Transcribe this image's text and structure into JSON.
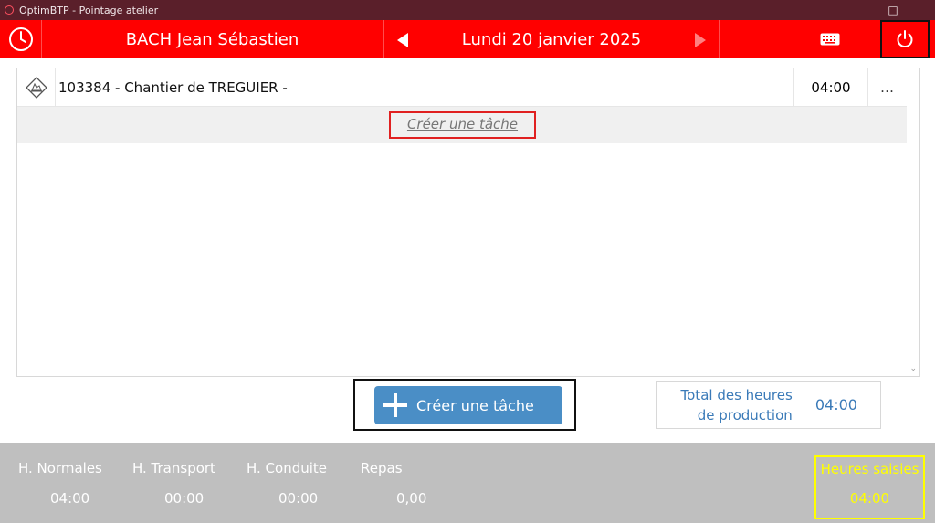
{
  "window": {
    "title": "OptimBTP - Pointage atelier",
    "maximize_glyph": "□",
    "close_glyph": "✕"
  },
  "header": {
    "employee_name": "BACH Jean Sébastien",
    "date_label": "Lundi 20 janvier 2025",
    "icons": [
      "clock-icon",
      "prev-day-icon",
      "next-day-icon",
      "keyboard-icon",
      "power-icon"
    ],
    "colors": {
      "header_bg": "#ff0000",
      "titlebar_bg": "#5a1f2a"
    }
  },
  "list": {
    "items": [
      {
        "label": "103384 - Chantier de TREGUIER -",
        "hours": "04:00",
        "more": "…",
        "icon": "site-icon"
      }
    ],
    "create_task_link": "Créer une tâche"
  },
  "actions": {
    "create_task_button": "Créer une tâche",
    "button_color": "#4a8ec6"
  },
  "totals": {
    "label_line1": "Total des heures",
    "label_line2": "de production",
    "value": "04:00"
  },
  "footer": {
    "stats": [
      {
        "label": "H. Normales",
        "value": "04:00"
      },
      {
        "label": "H. Transport",
        "value": "00:00"
      },
      {
        "label": "H. Conduite",
        "value": "00:00"
      },
      {
        "label": "Repas",
        "value": "0,00"
      }
    ],
    "heures_saisies": {
      "label": "Heures saisies",
      "value": "04:00",
      "color": "#ffff00"
    }
  }
}
